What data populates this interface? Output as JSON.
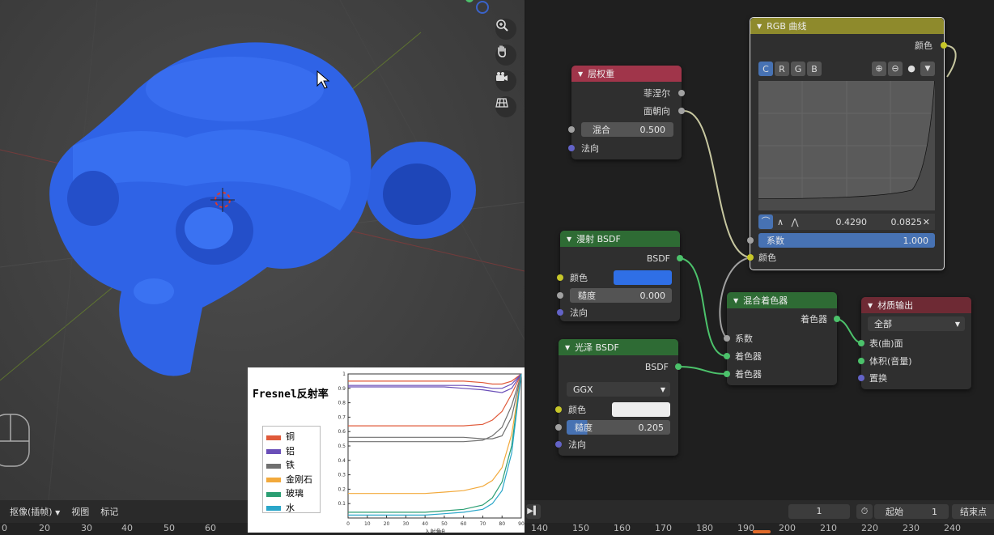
{
  "viewport": {
    "nav_icons": [
      "zoom-icon",
      "hand-icon",
      "camera-icon",
      "grid-icon"
    ]
  },
  "nodes": {
    "layer_weight": {
      "title": "层权重",
      "out_fresnel": "菲涅尔",
      "out_facing": "面朝向",
      "blend_label": "混合",
      "blend_value": "0.500",
      "in_normal": "法向"
    },
    "rgb_curves": {
      "title": "RGB 曲线",
      "out_color": "颜色",
      "channels": [
        "C",
        "R",
        "G",
        "B"
      ],
      "point_x": "0.4290",
      "point_y": "0.0825",
      "factor_label": "系数",
      "factor_value": "1.000",
      "in_color": "颜色"
    },
    "diffuse": {
      "title": "漫射 BSDF",
      "out_bsdf": "BSDF",
      "in_color": "颜色",
      "rough_label": "糙度",
      "rough_value": "0.000",
      "in_normal": "法向",
      "color_swatch": "#2f6fe6"
    },
    "glossy": {
      "title": "光泽 BSDF",
      "out_bsdf": "BSDF",
      "dist": "GGX",
      "in_color": "颜色",
      "rough_label": "糙度",
      "rough_value": "0.205",
      "in_normal": "法向",
      "color_swatch": "#eeeeee"
    },
    "mix_shader": {
      "title": "混合着色器",
      "out_shader": "着色器",
      "in_fac": "系数",
      "in_shader1": "着色器",
      "in_shader2": "着色器"
    },
    "material_output": {
      "title": "材质输出",
      "target": "全部",
      "in_surface": "表(曲)面",
      "in_volume": "体积(音量)",
      "in_displace": "置换"
    }
  },
  "bottom_bar": {
    "mode": "抠像(插帧)",
    "view": "视图",
    "marker": "标记",
    "frame": "1",
    "start_label": "起始",
    "start_value": "1",
    "end_label": "结束点"
  },
  "ruler": {
    "left_ticks": [
      "0",
      "20",
      "30",
      "40",
      "50",
      "60"
    ],
    "right_ticks": [
      "140",
      "150",
      "160",
      "170",
      "180",
      "190",
      "200",
      "210",
      "220",
      "230",
      "240"
    ]
  },
  "fresnel_chart": {
    "title": "Fresnel反射率",
    "xlabel": "入射角θ",
    "chart_data": {
      "type": "line",
      "title": "Fresnel反射率",
      "xlabel": "入射角θ",
      "ylabel": "",
      "xlim": [
        0,
        90
      ],
      "ylim": [
        0,
        1
      ],
      "x_ticks": [
        "0",
        "10",
        "20",
        "30",
        "40",
        "50",
        "60",
        "70",
        "80",
        "90"
      ],
      "y_ticks": [
        "0.1",
        "0.2",
        "0.3",
        "0.4",
        "0.5",
        "0.6",
        "0.7",
        "0.8",
        "0.9",
        "1"
      ],
      "x": [
        0,
        10,
        20,
        30,
        40,
        50,
        60,
        70,
        75,
        80,
        85,
        90
      ],
      "legend": [
        "铜",
        "铝",
        "铁",
        "金刚石",
        "玻璃",
        "水"
      ],
      "series": [
        {
          "name": "铜",
          "color": "#e05a3a",
          "values": [
            0.95,
            0.95,
            0.95,
            0.95,
            0.95,
            0.95,
            0.95,
            0.94,
            0.93,
            0.93,
            0.95,
            1.0
          ]
        },
        {
          "name": "铜",
          "color": "#e05a3a",
          "values": [
            0.64,
            0.64,
            0.64,
            0.64,
            0.64,
            0.64,
            0.64,
            0.65,
            0.68,
            0.74,
            0.86,
            1.0
          ]
        },
        {
          "name": "铝",
          "color": "#6a4fb8",
          "values": [
            0.91,
            0.91,
            0.91,
            0.91,
            0.91,
            0.91,
            0.9,
            0.89,
            0.88,
            0.87,
            0.9,
            1.0
          ]
        },
        {
          "name": "铝",
          "color": "#6a4fb8",
          "values": [
            0.92,
            0.92,
            0.92,
            0.92,
            0.92,
            0.92,
            0.92,
            0.91,
            0.9,
            0.9,
            0.93,
            1.0
          ]
        },
        {
          "name": "铁",
          "color": "#707070",
          "values": [
            0.56,
            0.56,
            0.56,
            0.56,
            0.56,
            0.56,
            0.56,
            0.55,
            0.55,
            0.57,
            0.7,
            1.0
          ]
        },
        {
          "name": "铁",
          "color": "#707070",
          "values": [
            0.53,
            0.53,
            0.53,
            0.53,
            0.53,
            0.53,
            0.53,
            0.54,
            0.57,
            0.63,
            0.78,
            1.0
          ]
        },
        {
          "name": "金刚石",
          "color": "#f2a93b",
          "values": [
            0.17,
            0.17,
            0.17,
            0.17,
            0.17,
            0.18,
            0.19,
            0.22,
            0.26,
            0.35,
            0.58,
            1.0
          ]
        },
        {
          "name": "玻璃",
          "color": "#2a9e72",
          "values": [
            0.04,
            0.04,
            0.04,
            0.04,
            0.04,
            0.05,
            0.06,
            0.09,
            0.14,
            0.25,
            0.5,
            1.0
          ]
        },
        {
          "name": "水",
          "color": "#2aa6c9",
          "values": [
            0.02,
            0.02,
            0.02,
            0.02,
            0.02,
            0.03,
            0.04,
            0.06,
            0.1,
            0.19,
            0.45,
            1.0
          ]
        }
      ]
    }
  }
}
